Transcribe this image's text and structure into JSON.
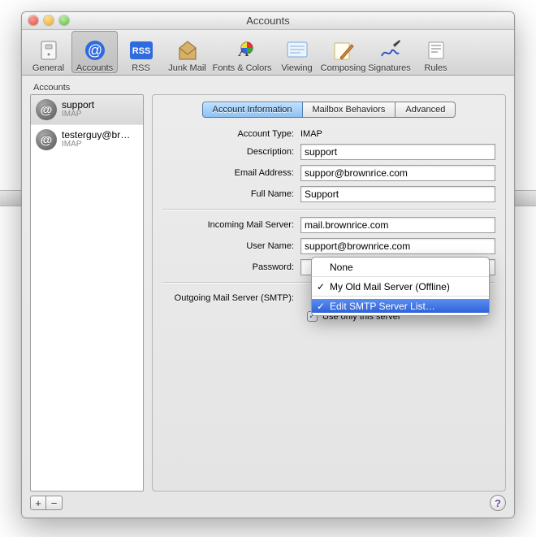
{
  "title": "Accounts",
  "toolbar": [
    "General",
    "Accounts",
    "RSS",
    "Junk Mail",
    "Fonts & Colors",
    "Viewing",
    "Composing",
    "Signatures",
    "Rules"
  ],
  "sidebar": {
    "label": "Accounts",
    "accounts": [
      {
        "name": "support",
        "type": "IMAP",
        "selected": true
      },
      {
        "name": "testerguy@br…",
        "type": "IMAP",
        "selected": false
      }
    ]
  },
  "tabs": [
    "Account Information",
    "Mailbox Behaviors",
    "Advanced"
  ],
  "form": {
    "account_type_label": "Account Type:",
    "account_type_value": "IMAP",
    "description_label": "Description:",
    "description_value": "support",
    "email_label": "Email Address:",
    "email_value": "suppor@brownrice.com",
    "fullname_label": "Full Name:",
    "fullname_value": "Support",
    "incoming_label": "Incoming Mail Server:",
    "incoming_value": "mail.brownrice.com",
    "username_label": "User Name:",
    "username_value": "support@brownrice.com",
    "password_label": "Password:",
    "password_value": "",
    "outgoing_label": "Outgoing Mail Server (SMTP):",
    "use_only_label": "Use only this server",
    "use_only_checked": true
  },
  "smtp_menu": [
    "None",
    "My Old Mail Server (Offline)",
    "Edit SMTP Server List…"
  ]
}
